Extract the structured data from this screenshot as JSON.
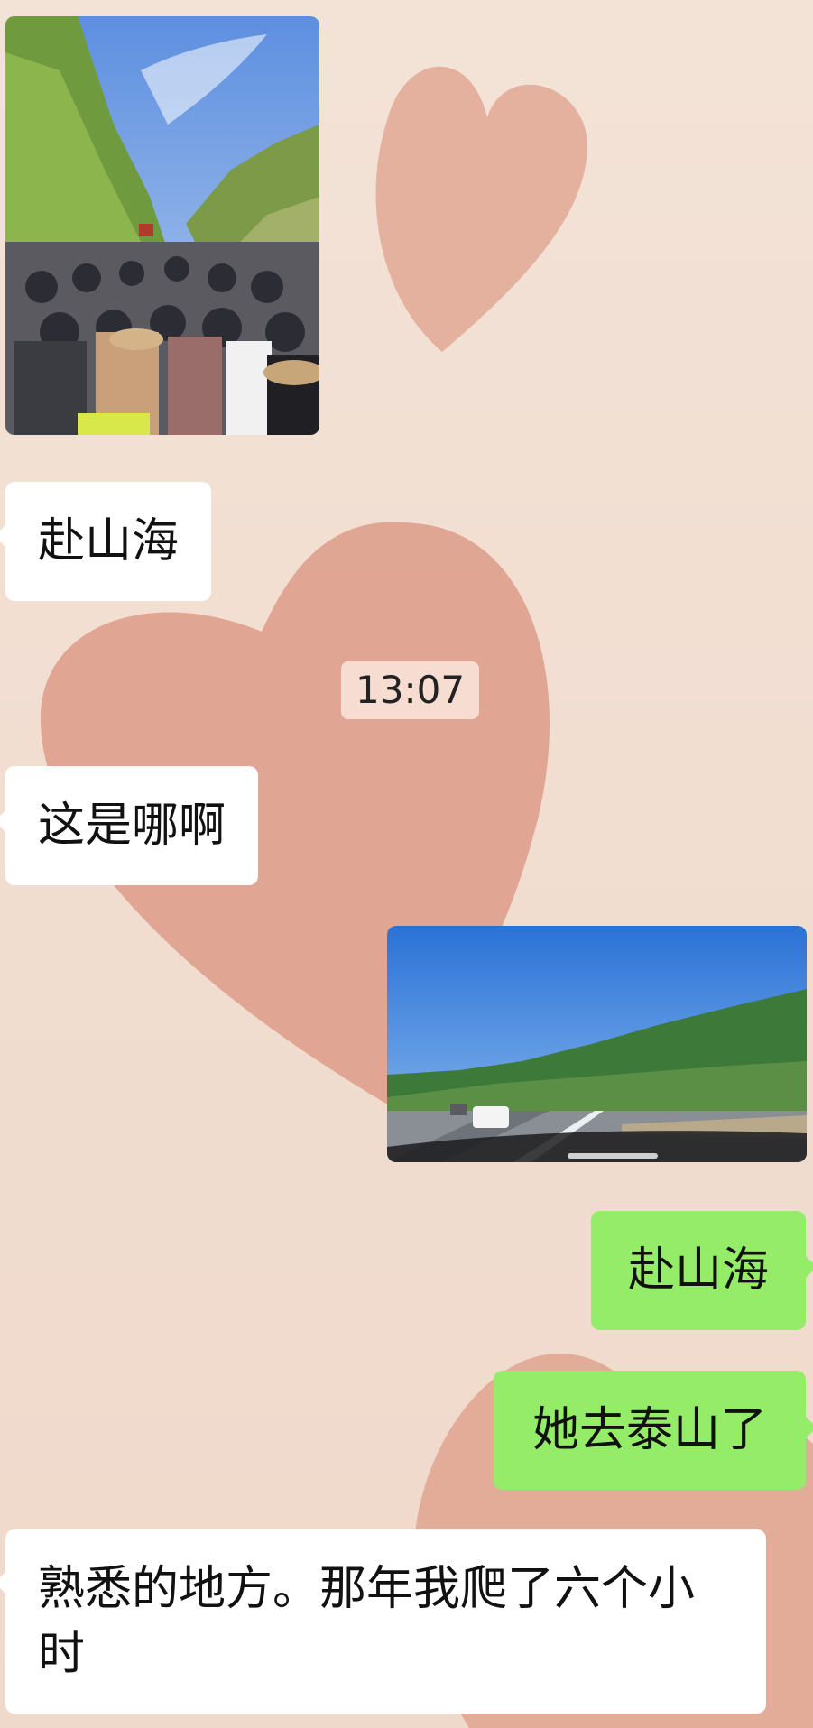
{
  "messages": [
    {
      "side": "in",
      "type": "image",
      "icon": "crowd-mountain-photo"
    },
    {
      "side": "in",
      "type": "text",
      "text": "赴山海"
    },
    {
      "type": "timestamp",
      "text": "13:07"
    },
    {
      "side": "in",
      "type": "text",
      "text": "这是哪啊"
    },
    {
      "side": "out",
      "type": "image",
      "icon": "highway-mountain-photo"
    },
    {
      "side": "out",
      "type": "text",
      "text": "赴山海"
    },
    {
      "side": "out",
      "type": "text",
      "text": "她去泰山了"
    },
    {
      "side": "in",
      "type": "text",
      "text": "熟悉的地方。那年我爬了六个小时"
    }
  ],
  "colors": {
    "incoming_bubble": "#ffffff",
    "outgoing_bubble": "#95ec69",
    "background": "#f0ddd0",
    "heart": "#e0a593"
  }
}
